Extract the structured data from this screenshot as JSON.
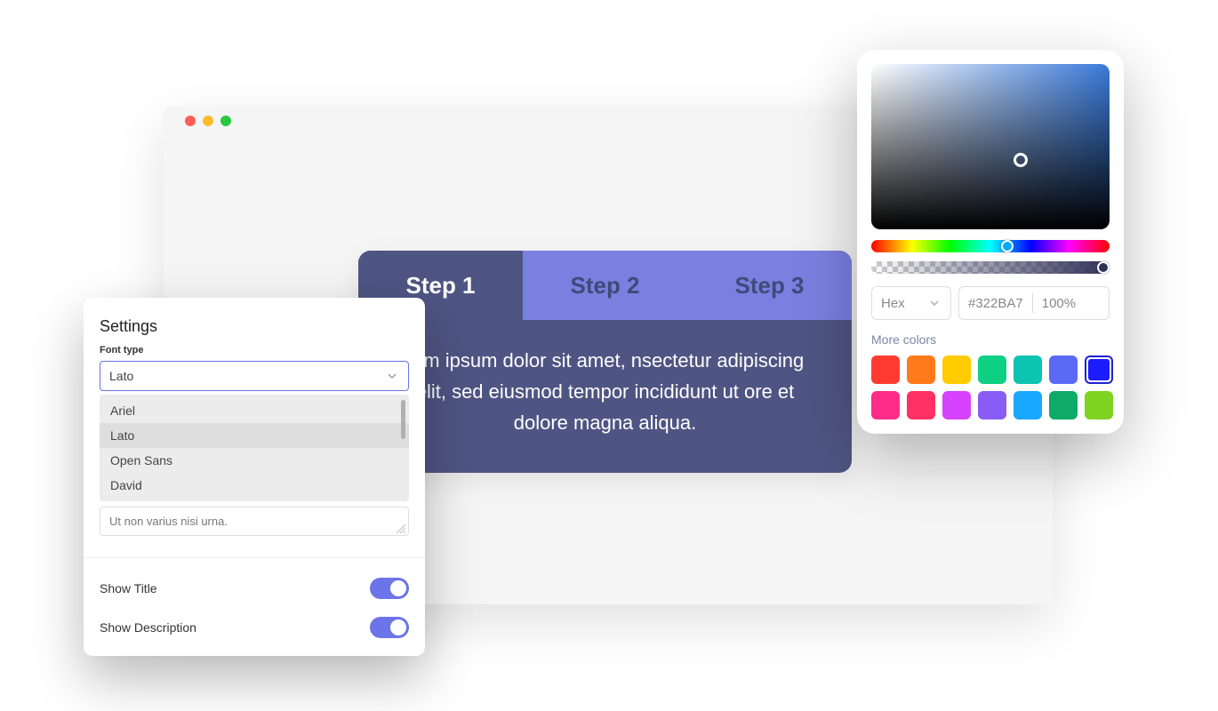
{
  "browser": {
    "steps": {
      "tabs": [
        {
          "label": "Step 1",
          "active": true
        },
        {
          "label": "Step 2",
          "active": false
        },
        {
          "label": "Step 3",
          "active": false
        }
      ],
      "body": "rem ipsum dolor sit amet, nsectetur adipiscing elit, sed eiusmod tempor incididunt ut ore et dolore magna aliqua."
    }
  },
  "settings": {
    "title": "Settings",
    "font_type_label": "Font type",
    "font_selected": "Lato",
    "font_options": [
      "Ariel",
      "Lato",
      "Open Sans",
      "David"
    ],
    "textarea_value": "Ut non varius nisi urna.",
    "toggles": [
      {
        "label": "Show Title",
        "on": true
      },
      {
        "label": "Show Description",
        "on": true
      }
    ]
  },
  "colorpicker": {
    "format_label": "Hex",
    "hex_value": "#322BA7",
    "opacity_value": "100%",
    "more_colors_label": "More colors",
    "swatches_row1": [
      "#ff3b30",
      "#ff7a1a",
      "#ffcc00",
      "#0ecf84",
      "#0dc4b0",
      "#5b6af5",
      "#1c1cff"
    ],
    "swatches_row2": [
      "#ff2d87",
      "#ff3064",
      "#d642ff",
      "#8a5cf6",
      "#1aa7ff",
      "#0fa968",
      "#7fd321"
    ],
    "selected_swatch_index": 6
  }
}
